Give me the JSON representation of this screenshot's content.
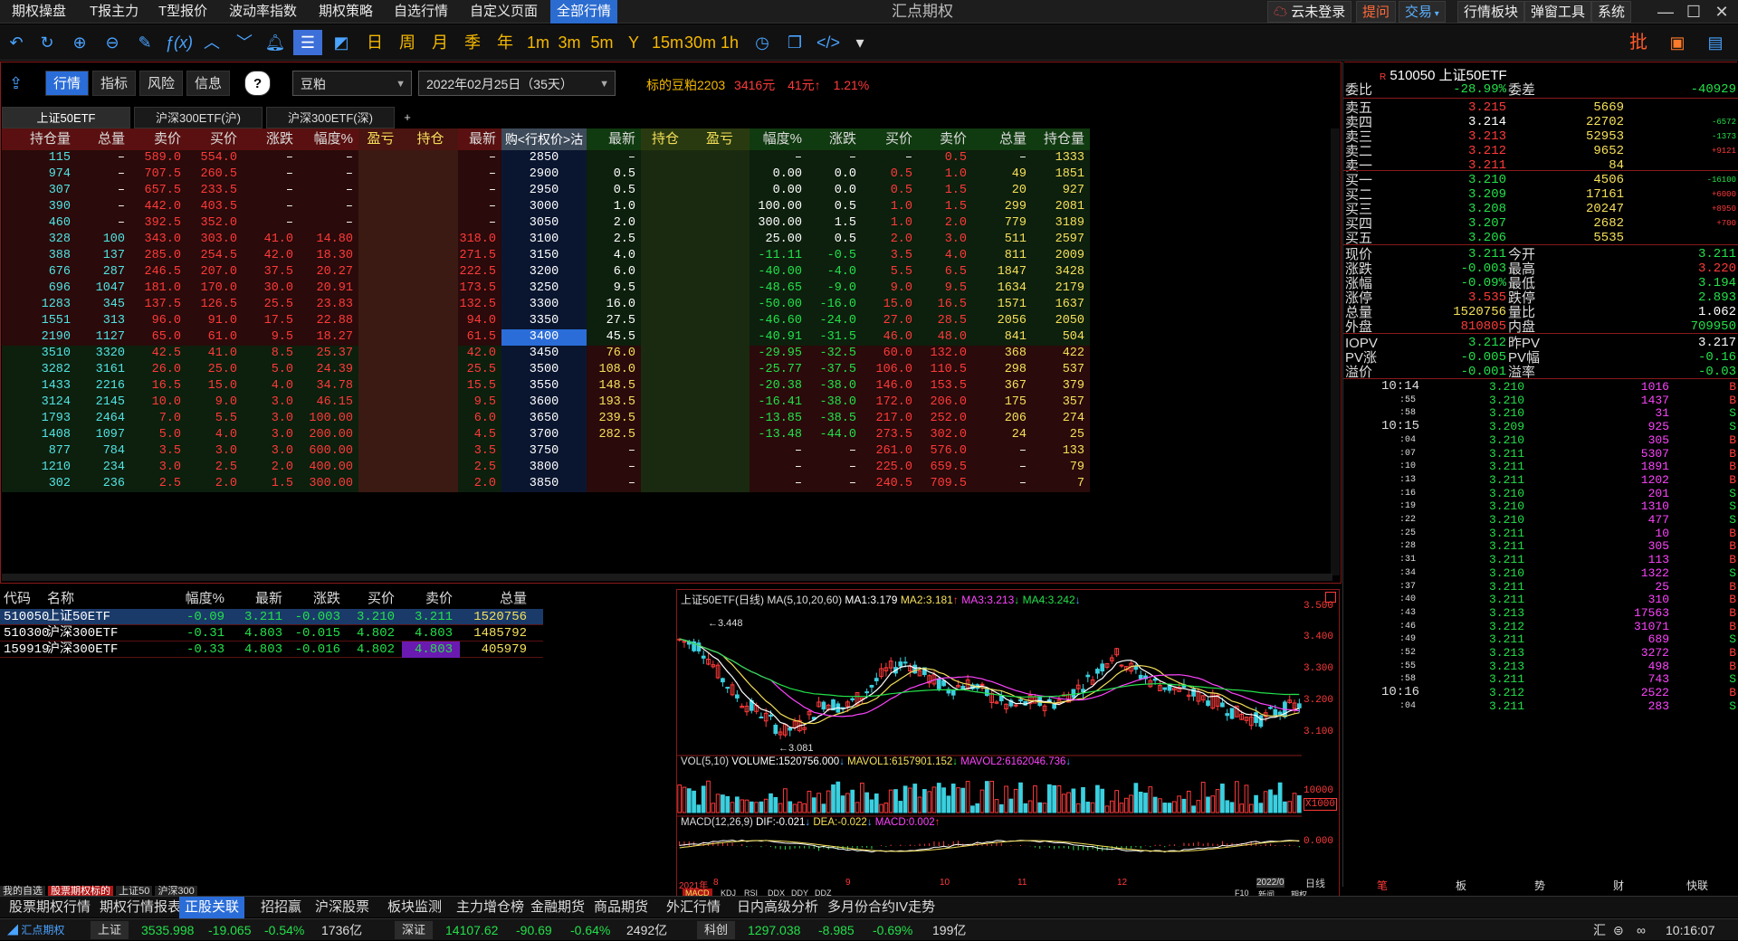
{
  "menu": {
    "items": [
      "期权操盘",
      "T报主力",
      "T型报价",
      "波动率指数",
      "期权策略",
      "自选行情",
      "自定义页面",
      "全部行情"
    ],
    "active": "全部行情",
    "app_title": "汇点期权",
    "right_buttons": {
      "login": "云未登录",
      "warn": "提问",
      "trade": "交易",
      "board": "行情板块",
      "tools": "弹窗工具",
      "system": "系统"
    }
  },
  "toolbar": {
    "text_buttons": [
      "日",
      "周",
      "月",
      "季",
      "年",
      "1m",
      "3m",
      "5m",
      "Y",
      "15m",
      "30m",
      "1h"
    ],
    "right_batch": "批"
  },
  "option_panel": {
    "tabs": [
      "行情",
      "指标",
      "风险",
      "信息"
    ],
    "help": "?",
    "variety": "豆粕",
    "expiry": "2022年02月25日（35天）",
    "underlying_label": "标的豆粕2203",
    "underlying_price": "3416元",
    "underlying_change": "41元",
    "underlying_pct": "1.21%",
    "sub_tabs": [
      "上证50ETF",
      "沪深300ETF(沪)",
      "沪深300ETF(深)",
      "+"
    ],
    "headers_left": [
      "持仓量",
      "总量",
      "卖价",
      "买价",
      "涨跌",
      "幅度%",
      "盈亏",
      "持仓",
      "最新"
    ],
    "header_mid": "购<行权价>沽",
    "headers_right": [
      "最新",
      "持仓",
      "盈亏",
      "幅度%",
      "涨跌",
      "买价",
      "卖价",
      "总量",
      "持仓量"
    ],
    "rows": [
      {
        "l": [
          "115",
          "–",
          "589.0",
          "554.0",
          "–",
          "–",
          "",
          "",
          "–"
        ],
        "k": "2850",
        "r": [
          "–",
          "",
          "",
          "–",
          "–",
          "–",
          "0.5",
          "–",
          "1333"
        ]
      },
      {
        "l": [
          "974",
          "–",
          "707.5",
          "260.5",
          "–",
          "–",
          "",
          "",
          "–"
        ],
        "k": "2900",
        "r": [
          "0.5",
          "",
          "",
          "0.00",
          "0.0",
          "0.5",
          "1.0",
          "49",
          "1851"
        ]
      },
      {
        "l": [
          "307",
          "–",
          "657.5",
          "233.5",
          "–",
          "–",
          "",
          "",
          "–"
        ],
        "k": "2950",
        "r": [
          "0.5",
          "",
          "",
          "0.00",
          "0.0",
          "0.5",
          "1.5",
          "20",
          "927"
        ]
      },
      {
        "l": [
          "390",
          "–",
          "442.0",
          "403.5",
          "–",
          "–",
          "",
          "",
          "–"
        ],
        "k": "3000",
        "r": [
          "1.0",
          "",
          "",
          "100.00",
          "0.5",
          "1.0",
          "1.5",
          "299",
          "2081"
        ]
      },
      {
        "l": [
          "460",
          "–",
          "392.5",
          "352.0",
          "–",
          "–",
          "",
          "",
          "–"
        ],
        "k": "3050",
        "r": [
          "2.0",
          "",
          "",
          "300.00",
          "1.5",
          "1.0",
          "2.0",
          "779",
          "3189"
        ]
      },
      {
        "l": [
          "328",
          "100",
          "343.0",
          "303.0",
          "41.0",
          "14.80",
          "",
          "",
          "318.0"
        ],
        "k": "3100",
        "r": [
          "2.5",
          "",
          "",
          "25.00",
          "0.5",
          "2.0",
          "3.0",
          "511",
          "2597"
        ]
      },
      {
        "l": [
          "388",
          "137",
          "285.0",
          "254.5",
          "42.0",
          "18.30",
          "",
          "",
          "271.5"
        ],
        "k": "3150",
        "r": [
          "4.0",
          "",
          "",
          "-11.11",
          "-0.5",
          "3.5",
          "4.0",
          "811",
          "2009"
        ]
      },
      {
        "l": [
          "676",
          "287",
          "246.5",
          "207.0",
          "37.5",
          "20.27",
          "",
          "",
          "222.5"
        ],
        "k": "3200",
        "r": [
          "6.0",
          "",
          "",
          "-40.00",
          "-4.0",
          "5.5",
          "6.5",
          "1847",
          "3428"
        ]
      },
      {
        "l": [
          "696",
          "1047",
          "181.0",
          "170.0",
          "30.0",
          "20.91",
          "",
          "",
          "173.5"
        ],
        "k": "3250",
        "r": [
          "9.5",
          "",
          "",
          "-48.65",
          "-9.0",
          "9.0",
          "9.5",
          "1634",
          "2179"
        ]
      },
      {
        "l": [
          "1283",
          "345",
          "137.5",
          "126.5",
          "25.5",
          "23.83",
          "",
          "",
          "132.5"
        ],
        "k": "3300",
        "r": [
          "16.0",
          "",
          "",
          "-50.00",
          "-16.0",
          "15.0",
          "16.5",
          "1571",
          "1637"
        ]
      },
      {
        "l": [
          "1551",
          "313",
          "96.0",
          "91.0",
          "17.5",
          "22.88",
          "",
          "",
          "94.0"
        ],
        "k": "3350",
        "r": [
          "27.5",
          "",
          "",
          "-46.60",
          "-24.0",
          "27.0",
          "28.5",
          "2056",
          "2050"
        ]
      },
      {
        "l": [
          "2190",
          "1127",
          "65.0",
          "61.0",
          "9.5",
          "18.27",
          "",
          "",
          "61.5"
        ],
        "k": "3400",
        "r": [
          "45.5",
          "",
          "",
          "-40.91",
          "-31.5",
          "46.0",
          "48.0",
          "841",
          "504"
        ]
      },
      {
        "l": [
          "3510",
          "3320",
          "42.5",
          "41.0",
          "8.5",
          "25.37",
          "",
          "",
          "42.0"
        ],
        "k": "3450",
        "r": [
          "76.0",
          "",
          "",
          "-29.95",
          "-32.5",
          "60.0",
          "132.0",
          "368",
          "422"
        ]
      },
      {
        "l": [
          "3282",
          "3161",
          "26.0",
          "25.0",
          "5.0",
          "24.39",
          "",
          "",
          "25.5"
        ],
        "k": "3500",
        "r": [
          "108.0",
          "",
          "",
          "-25.77",
          "-37.5",
          "106.0",
          "110.5",
          "298",
          "537"
        ]
      },
      {
        "l": [
          "1433",
          "2216",
          "16.5",
          "15.0",
          "4.0",
          "34.78",
          "",
          "",
          "15.5"
        ],
        "k": "3550",
        "r": [
          "148.5",
          "",
          "",
          "-20.38",
          "-38.0",
          "146.0",
          "153.5",
          "367",
          "379"
        ]
      },
      {
        "l": [
          "3124",
          "2145",
          "10.0",
          "9.0",
          "3.0",
          "46.15",
          "",
          "",
          "9.5"
        ],
        "k": "3600",
        "r": [
          "193.5",
          "",
          "",
          "-16.41",
          "-38.0",
          "172.0",
          "206.0",
          "175",
          "357"
        ]
      },
      {
        "l": [
          "1793",
          "2464",
          "7.0",
          "5.5",
          "3.0",
          "100.00",
          "",
          "",
          "6.0"
        ],
        "k": "3650",
        "r": [
          "239.5",
          "",
          "",
          "-13.85",
          "-38.5",
          "217.0",
          "252.0",
          "206",
          "274"
        ]
      },
      {
        "l": [
          "1408",
          "1097",
          "5.0",
          "4.0",
          "3.0",
          "200.00",
          "",
          "",
          "4.5"
        ],
        "k": "3700",
        "r": [
          "282.5",
          "",
          "",
          "-13.48",
          "-44.0",
          "273.5",
          "302.0",
          "24",
          "25"
        ]
      },
      {
        "l": [
          "877",
          "784",
          "3.5",
          "3.0",
          "3.0",
          "600.00",
          "",
          "",
          "3.5"
        ],
        "k": "3750",
        "r": [
          "–",
          "",
          "",
          "–",
          "–",
          "261.0",
          "576.0",
          "–",
          "133"
        ]
      },
      {
        "l": [
          "1210",
          "234",
          "3.0",
          "2.5",
          "2.0",
          "400.00",
          "",
          "",
          "2.5"
        ],
        "k": "3800",
        "r": [
          "–",
          "",
          "",
          "–",
          "–",
          "225.0",
          "659.5",
          "–",
          "79"
        ]
      },
      {
        "l": [
          "302",
          "236",
          "2.5",
          "2.0",
          "1.5",
          "300.00",
          "",
          "",
          "2.0"
        ],
        "k": "3850",
        "r": [
          "–",
          "",
          "",
          "–",
          "–",
          "240.5",
          "709.5",
          "–",
          "7"
        ]
      }
    ],
    "atm_strike": "3400"
  },
  "stock_list": {
    "headers": [
      "代码",
      "名称",
      "幅度%",
      "最新",
      "涨跌",
      "买价",
      "卖价",
      "总量"
    ],
    "rows": [
      [
        "510050",
        "上证50ETF",
        "-0.09",
        "3.211",
        "-0.003",
        "3.210",
        "3.211",
        "1520756"
      ],
      [
        "510300",
        "沪深300ETF",
        "-0.31",
        "4.803",
        "-0.015",
        "4.802",
        "4.803",
        "1485792"
      ],
      [
        "159919",
        "沪深300ETF",
        "-0.33",
        "4.803",
        "-0.016",
        "4.802",
        "4.803",
        "405979"
      ]
    ],
    "bottom_tabs": [
      "我的自选",
      "股票期权标的",
      "上证50",
      "沪深300"
    ]
  },
  "chart": {
    "header": "上证50ETF(日线)",
    "ma_label": "MA(5,10,20,60)",
    "ma1": "MA1:3.179",
    "ma2": "MA2:3.181",
    "ma3": "MA3:3.213",
    "ma4": "MA4:3.242",
    "high_mark": "3.448",
    "low_mark": "3.081",
    "y_ticks": [
      "3.500",
      "3.400",
      "3.300",
      "3.200",
      "3.100"
    ],
    "vol_label": "VOL(5,10)",
    "volume": "VOLUME:1520756.000",
    "mavol1": "MAVOL1:6157901.152",
    "mavol2": "MAVOL2:6162046.736",
    "vol_tick": "10000",
    "vol_unit": "X1000",
    "macd_label": "MACD(12,26,9)",
    "dif": "DIF:-0.021",
    "dea": "DEA:-0.022",
    "macd": "MACD:0.002",
    "macd_tick": "0.000",
    "x_labels": [
      "2021年",
      "8",
      "9",
      "10",
      "11",
      "12",
      "2022/0"
    ],
    "indicators": [
      "MACD",
      "KDJ",
      "RSI",
      "DDX",
      "DDY",
      "DDZ"
    ],
    "period": "日线",
    "f10": "F10",
    "news": "新闻",
    "opt": "期权"
  },
  "quote": {
    "code": "510050",
    "name": "上证50ETF",
    "weibi_label": "委比",
    "weibi": "-28.99%",
    "weicha_label": "委差",
    "weicha": "-40929",
    "asks": [
      {
        "label": "卖五",
        "price": "3.215",
        "vol": "5669",
        "chg": ""
      },
      {
        "label": "卖四",
        "price": "3.214",
        "vol": "22702",
        "chg": "-6572"
      },
      {
        "label": "卖三",
        "price": "3.213",
        "vol": "52953",
        "chg": "-1373"
      },
      {
        "label": "卖二",
        "price": "3.212",
        "vol": "9652",
        "chg": "+9121"
      },
      {
        "label": "卖一",
        "price": "3.211",
        "vol": "84",
        "chg": ""
      }
    ],
    "bids": [
      {
        "label": "买一",
        "price": "3.210",
        "vol": "4506",
        "chg": "-16100"
      },
      {
        "label": "买二",
        "price": "3.209",
        "vol": "17161",
        "chg": "+6000"
      },
      {
        "label": "买三",
        "price": "3.208",
        "vol": "20247",
        "chg": "+8950"
      },
      {
        "label": "买四",
        "price": "3.207",
        "vol": "2682",
        "chg": "+700"
      },
      {
        "label": "买五",
        "price": "3.206",
        "vol": "5535",
        "chg": ""
      }
    ],
    "stats": [
      {
        "l1": "现价",
        "v1": "3.211",
        "l2": "今开",
        "v2": "3.211"
      },
      {
        "l1": "涨跌",
        "v1": "-0.003",
        "l2": "最高",
        "v2": "3.220"
      },
      {
        "l1": "涨幅",
        "v1": "-0.09%",
        "l2": "最低",
        "v2": "3.194"
      },
      {
        "l1": "涨停",
        "v1": "3.535",
        "l2": "跌停",
        "v2": "2.893"
      },
      {
        "l1": "总量",
        "v1": "1520756",
        "l2": "量比",
        "v2": "1.062"
      },
      {
        "l1": "外盘",
        "v1": "810805",
        "l2": "内盘",
        "v2": "709950"
      }
    ],
    "iopv": [
      {
        "l1": "IOPV",
        "v1": "3.212",
        "l2": "昨PV",
        "v2": "3.217"
      },
      {
        "l1": "PV涨",
        "v1": "-0.005",
        "l2": "PV幅",
        "v2": "-0.16"
      },
      {
        "l1": "溢价",
        "v1": "-0.001",
        "l2": "溢率",
        "v2": "-0.03"
      }
    ],
    "ticks": [
      [
        "10:14",
        "3.210",
        "1016",
        "B"
      ],
      [
        ":55",
        "3.210",
        "1437",
        "B"
      ],
      [
        ":58",
        "3.210",
        "31",
        "S"
      ],
      [
        "10:15",
        "3.209",
        "925",
        "S"
      ],
      [
        ":04",
        "3.210",
        "305",
        "B"
      ],
      [
        ":07",
        "3.211",
        "5307",
        "B"
      ],
      [
        ":10",
        "3.211",
        "1891",
        "B"
      ],
      [
        ":13",
        "3.211",
        "1202",
        "B"
      ],
      [
        ":16",
        "3.210",
        "201",
        "S"
      ],
      [
        ":19",
        "3.210",
        "1310",
        "S"
      ],
      [
        ":22",
        "3.210",
        "477",
        "S"
      ],
      [
        ":25",
        "3.211",
        "10",
        "B"
      ],
      [
        ":28",
        "3.211",
        "305",
        "B"
      ],
      [
        ":31",
        "3.211",
        "113",
        "B"
      ],
      [
        ":34",
        "3.210",
        "1322",
        "S"
      ],
      [
        ":37",
        "3.211",
        "25",
        "B"
      ],
      [
        ":40",
        "3.211",
        "310",
        "B"
      ],
      [
        ":43",
        "3.213",
        "17563",
        "B"
      ],
      [
        ":46",
        "3.212",
        "31071",
        "B"
      ],
      [
        ":49",
        "3.211",
        "689",
        "S"
      ],
      [
        ":52",
        "3.213",
        "3272",
        "B"
      ],
      [
        ":55",
        "3.213",
        "498",
        "B"
      ],
      [
        ":58",
        "3.211",
        "743",
        "S"
      ],
      [
        "10:16",
        "3.212",
        "2522",
        "B"
      ],
      [
        ":04",
        "3.211",
        "283",
        "S"
      ]
    ],
    "bottom_tabs": [
      "笔",
      "板",
      "势",
      "财",
      "快联"
    ]
  },
  "bottom_tabs": [
    "股票期权行情",
    "期权行情报表",
    "正股关联",
    "招招赢",
    "沪深股票",
    "板块监测",
    "主力增仓榜",
    "金融期货",
    "商品期货",
    "外汇行情",
    "日内高级分析",
    "多月份合约IV走势"
  ],
  "bottom_tab_active": "正股关联",
  "status": {
    "brand": "汇点期权",
    "sh_label": "上证",
    "sh_val": "3535.998",
    "sh_chg": "-19.065",
    "sh_pct": "-0.54%",
    "sh_amt": "1736亿",
    "sz_label": "深证",
    "sz_val": "14107.62",
    "sz_chg": "-90.69",
    "sz_pct": "-0.64%",
    "sz_amt": "2492亿",
    "kc_label": "科创",
    "kc_val": "1297.038",
    "kc_chg": "-8.985",
    "kc_pct": "-0.69%",
    "kc_amt": "199亿",
    "time": "10:16:07",
    "right_mark": "汇"
  }
}
